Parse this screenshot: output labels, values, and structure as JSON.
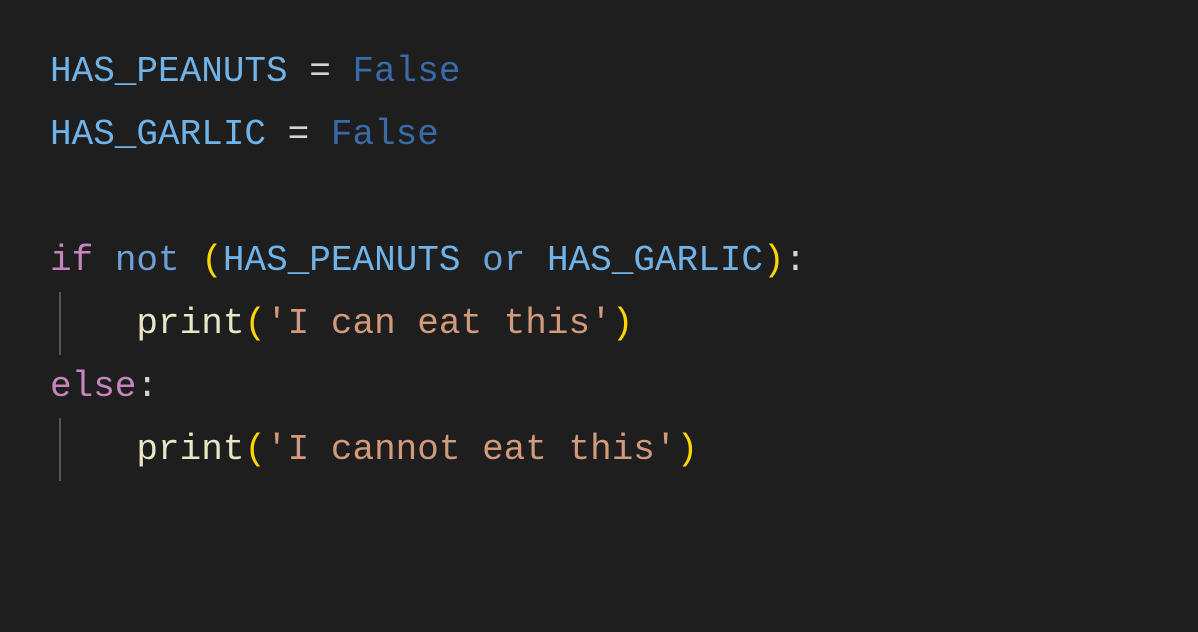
{
  "code": {
    "line1": {
      "var": "HAS_PEANUTS",
      "equals": " = ",
      "value": "False"
    },
    "line2": {
      "var": "HAS_GARLIC",
      "equals": " = ",
      "value": "False"
    },
    "line4": {
      "if": "if",
      "sp1": " ",
      "not": "not",
      "sp2": " ",
      "open": "(",
      "var1": "HAS_PEANUTS",
      "sp3": " ",
      "or": "or",
      "sp4": " ",
      "var2": "HAS_GARLIC",
      "close": ")",
      "colon": ":"
    },
    "line5": {
      "func": "print",
      "open": "(",
      "str": "'I can eat this'",
      "close": ")"
    },
    "line6": {
      "else": "else",
      "colon": ":"
    },
    "line7": {
      "func": "print",
      "open": "(",
      "str": "'I cannot eat this'",
      "close": ")"
    }
  }
}
